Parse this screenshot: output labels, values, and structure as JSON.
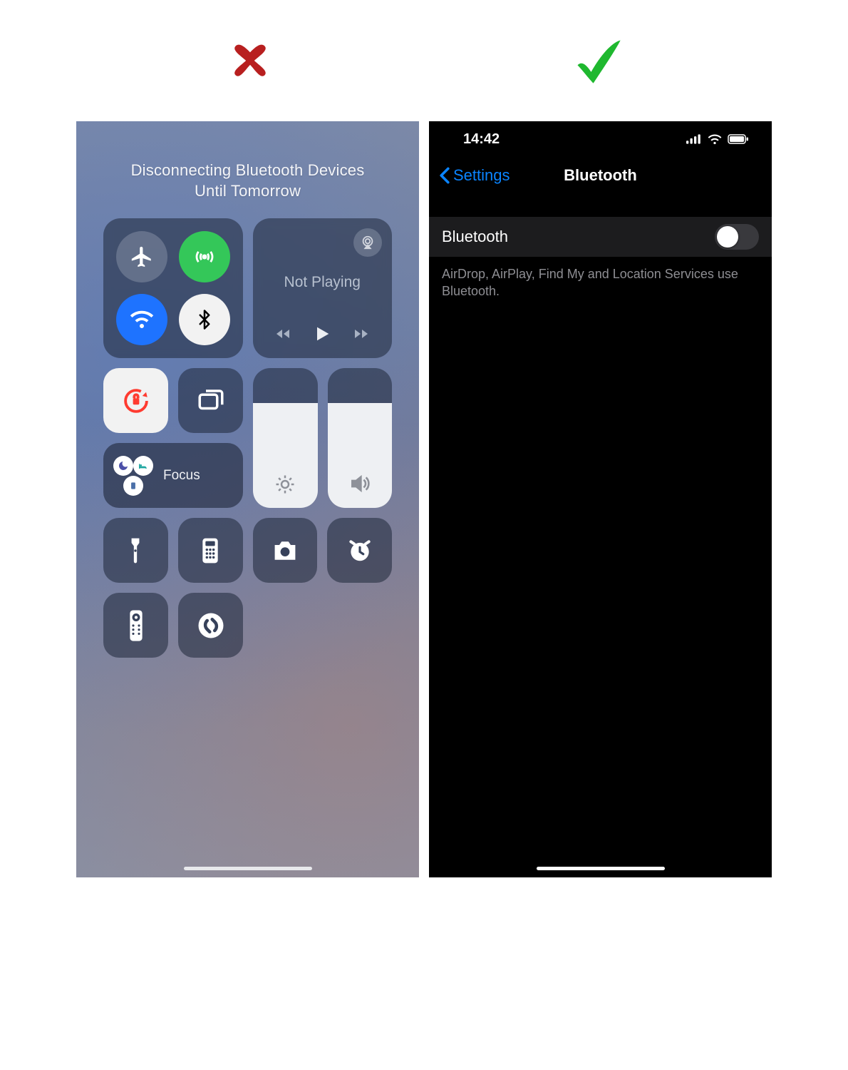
{
  "indicators": {
    "left_marker": "✘",
    "right_marker": "✔",
    "colors": {
      "x": "#b81f1f",
      "check": "#1fb82f"
    }
  },
  "control_center": {
    "title_line1": "Disconnecting Bluetooth Devices",
    "title_line2": "Until Tomorrow",
    "connectivity": {
      "airplane": "airplane-icon",
      "cellular": "cellular-icon",
      "wifi": "wifi-icon",
      "bluetooth": "bluetooth-icon"
    },
    "media": {
      "label": "Not Playing",
      "airplay": "airplay-icon",
      "prev": "rewind-icon",
      "play": "play-icon",
      "next": "forward-icon"
    },
    "lock_rotation": "rotation-lock-icon",
    "screen_mirror": "screen-mirror-icon",
    "focus_label": "Focus",
    "brightness_pct": 75,
    "volume_pct": 75,
    "shortcuts": {
      "flashlight": "flashlight-icon",
      "calculator": "calculator-icon",
      "camera": "camera-icon",
      "alarm": "alarm-icon",
      "remote": "remote-icon",
      "shazam": "shazam-icon"
    }
  },
  "settings": {
    "time": "14:42",
    "back_label": "Settings",
    "page_title": "Bluetooth",
    "row_label": "Bluetooth",
    "toggle_on": false,
    "footer": "AirDrop, AirPlay, Find My and Location Services use Bluetooth."
  }
}
